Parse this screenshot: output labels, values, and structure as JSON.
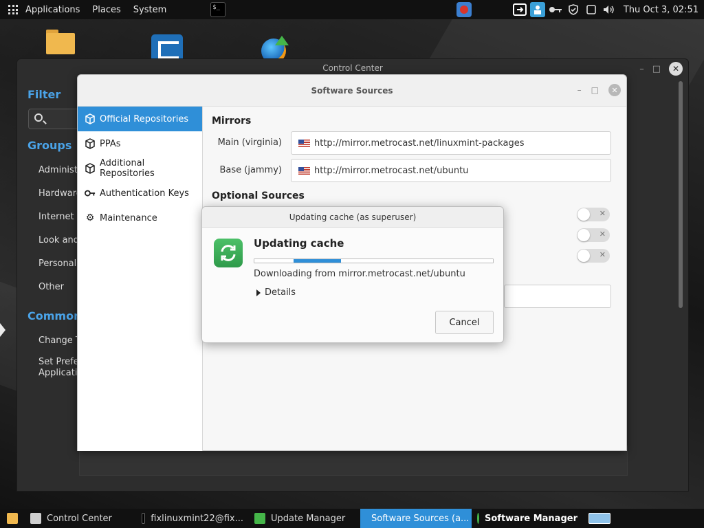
{
  "top_panel": {
    "menus": [
      "Applications",
      "Places",
      "System"
    ],
    "clock": "Thu Oct  3, 02:51"
  },
  "control_center": {
    "title": "Control Center",
    "filter_heading": "Filter",
    "groups_heading": "Groups",
    "groups": [
      "Administr",
      "Hardware",
      "Internet a",
      "Look and",
      "Personal",
      "Other"
    ],
    "common_heading": "Common",
    "common_items": [
      "Change T",
      "Set Prefer",
      "Applicatio"
    ]
  },
  "software_sources": {
    "title": "Software Sources",
    "nav": [
      {
        "label": "Official Repositories",
        "icon": "package-icon"
      },
      {
        "label": "PPAs",
        "icon": "package-icon"
      },
      {
        "label": "Additional Repositories",
        "icon": "package-icon"
      },
      {
        "label": "Authentication Keys",
        "icon": "key-icon"
      },
      {
        "label": "Maintenance",
        "icon": "gear-icon"
      }
    ],
    "mirrors_title": "Mirrors",
    "mirrors": [
      {
        "label": "Main (virginia)",
        "url": "http://mirror.metrocast.net/linuxmint-packages"
      },
      {
        "label": "Base (jammy)",
        "url": "http://mirror.metrocast.net/ubuntu"
      }
    ],
    "optional_title": "Optional Sources"
  },
  "dialog": {
    "title": "Updating cache (as superuser)",
    "heading": "Updating cache",
    "status": "Downloading from mirror.metrocast.net/ubuntu",
    "details_label": "Details",
    "cancel_label": "Cancel",
    "progress_indeterminate": true
  },
  "taskbar": {
    "items": [
      {
        "label": "Control Center"
      },
      {
        "label": "fixlinuxmint22@fix..."
      },
      {
        "label": "Update Manager"
      },
      {
        "label": "Software Sources (a..."
      },
      {
        "label": "Software Manager"
      }
    ]
  },
  "colors": {
    "accent": "#2f8fd8",
    "panel": "#111111",
    "dialog_icon": "#3cae58"
  }
}
